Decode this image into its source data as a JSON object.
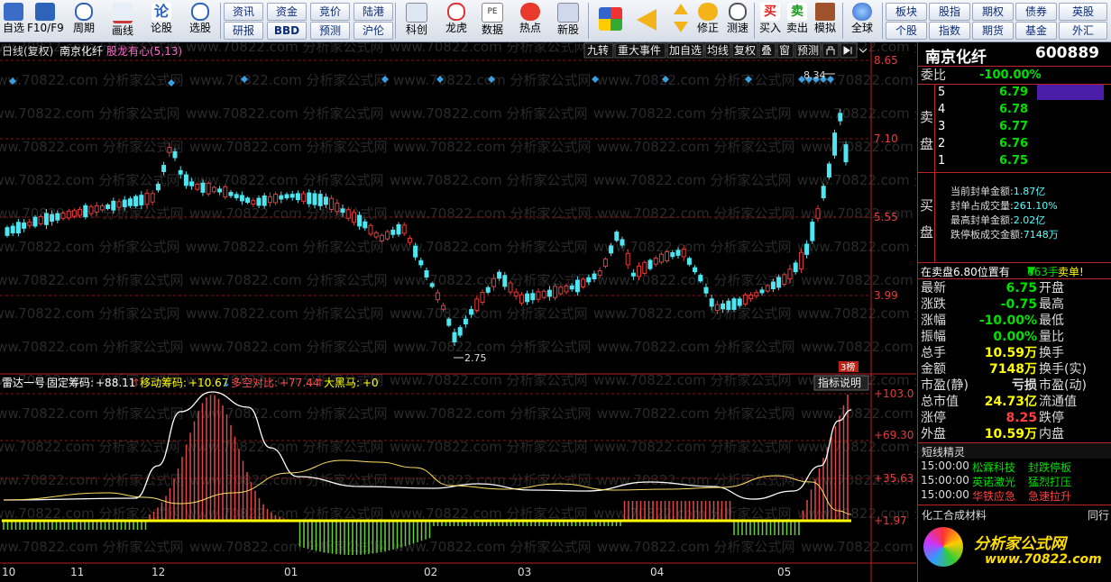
{
  "toolbar": {
    "items": [
      "自选",
      "F10/F9",
      "周期",
      "画线",
      "论股",
      "选股"
    ],
    "grid1": [
      [
        "资讯",
        "资金",
        "竞价",
        "陆港"
      ],
      [
        "研报",
        "BBD",
        "预测",
        "沪伦"
      ]
    ],
    "items2": [
      "科创",
      "龙虎",
      "数据",
      "热点",
      "新股"
    ],
    "items3": [
      "",
      "",
      "修正",
      "测速",
      "买入",
      "卖出",
      "模拟",
      "全球"
    ],
    "grid2": [
      [
        "板块",
        "股指",
        "期权",
        "债券",
        "英股"
      ],
      [
        "个股",
        "指数",
        "期货",
        "基金",
        "外汇"
      ]
    ]
  },
  "chart": {
    "header_period": "日线(复权)",
    "header_name": "南京化纤",
    "header_indicator": "股龙有心",
    "header_params": "(5,13)",
    "buttons": [
      "九转",
      "重大事件",
      "加自选",
      "均线",
      "复权",
      "叠",
      "窗",
      "预测"
    ],
    "price_ticks": [
      "8.65",
      "7.10",
      "5.55",
      "3.99"
    ],
    "high_label": "8.34",
    "low_label": "2.75",
    "bang_label": "3榜",
    "watermark": "www.70822.com 分析家公式网",
    "indicator_name": "雷达一号",
    "ind_fixed_label": "固定筹码:",
    "ind_fixed_value": "+88.11",
    "ind_move_label": "移动筹码:",
    "ind_move_value": "+10.67",
    "ind_ls_label": "多空对比:",
    "ind_ls_value": "+77.44",
    "ind_hm_label": "大黑马:",
    "ind_hm_value": "+0",
    "ind_help": "指标说明",
    "ind_ticks": [
      "+103.0",
      "+69.30",
      "+35.63",
      "+1.97"
    ],
    "months": [
      "10",
      "11",
      "12",
      "01",
      "02",
      "03",
      "04",
      "05"
    ]
  },
  "quote": {
    "name": "南京化纤",
    "code": "600889",
    "weibi_label": "委比",
    "weibi_value": "-100.00%",
    "sell_label": "卖盘",
    "sell_levels": [
      [
        "5",
        "6.79"
      ],
      [
        "4",
        "6.78"
      ],
      [
        "3",
        "6.77"
      ],
      [
        "2",
        "6.76"
      ],
      [
        "1",
        "6.75"
      ]
    ],
    "buy_label": "买盘",
    "seal_info": [
      [
        "当前封单金额:",
        "1.87亿"
      ],
      [
        "封单占成交量:",
        "261.10%"
      ],
      [
        "最高封单金额:",
        "2.02亿"
      ],
      [
        "跌停板成交金额:",
        "7148万"
      ]
    ],
    "sell_status_label": "在卖盘",
    "sell_status_price": "6.80",
    "sell_status_suffix": "位置有",
    "sell_status_qty": "663手",
    "sell_status_action": "卖单!",
    "fields": [
      [
        "最新",
        "6.75",
        "开盘",
        ""
      ],
      [
        "涨跌",
        "-0.75",
        "最高",
        ""
      ],
      [
        "涨幅",
        "-10.00%",
        "最低",
        ""
      ],
      [
        "振幅",
        "0.00%",
        "量比",
        ""
      ],
      [
        "总手",
        "10.59万",
        "换手",
        ""
      ],
      [
        "金额",
        "7148万",
        "换手(实)",
        ""
      ],
      [
        "市盈(静)",
        "亏损",
        "市盈(动)",
        ""
      ],
      [
        "总市值",
        "24.73亿",
        "流通值",
        ""
      ],
      [
        "涨停",
        "8.25",
        "跌停",
        ""
      ],
      [
        "外盘",
        "10.59万",
        "内盘",
        ""
      ]
    ],
    "short_title": "短线精灵",
    "short_items": [
      [
        "15:00:00",
        "松霖科技",
        "封跌停板"
      ],
      [
        "15:00:00",
        "英诺激光",
        "猛烈打压"
      ],
      [
        "15:00:00",
        "华铁应急",
        "急速拉升"
      ]
    ],
    "sector": "化工合成材料",
    "sector_right": "同行",
    "logo_text": "分析家公式网",
    "logo_url": "www.70822.com"
  }
}
